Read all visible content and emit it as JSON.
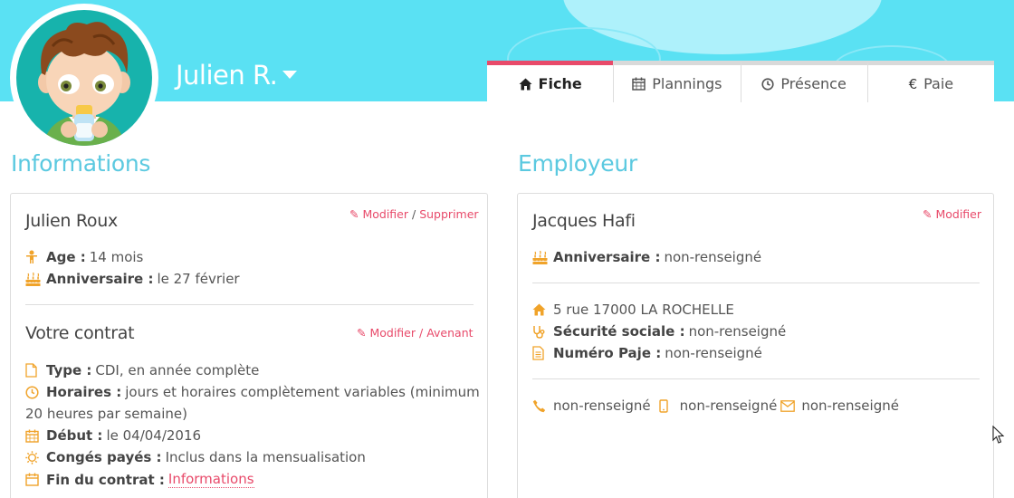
{
  "header": {
    "child_name": "Julien R.",
    "colors": {
      "sky": "#5ae1f3",
      "accent": "#e84a6a",
      "title": "#5bc9e0"
    }
  },
  "tabs": [
    {
      "label": "Fiche",
      "icon": "home-icon",
      "active": true
    },
    {
      "label": "Plannings",
      "icon": "calendar-icon",
      "active": false
    },
    {
      "label": "Présence",
      "icon": "clock-icon",
      "active": false
    },
    {
      "label": "Paie",
      "icon": "euro-icon",
      "active": false
    }
  ],
  "informations": {
    "section_title": "Informations",
    "child": {
      "name": "Julien Roux",
      "modify_label": "Modifier",
      "separator": "/",
      "delete_label": "Supprimer",
      "age_label": "Age :",
      "age_value": "14 mois",
      "birthday_label": "Anniversaire :",
      "birthday_value": "le 27 février"
    },
    "contract": {
      "title": "Votre contrat",
      "modify_label": "Modifier",
      "separator": "/",
      "amend_label": "Avenant",
      "type_label": "Type :",
      "type_value": "CDI, en année complète",
      "hours_label": "Horaires :",
      "hours_value_line1": "jours et horaires complètement variables (minimum",
      "hours_value_line2": "20 heures par semaine)",
      "start_label": "Début :",
      "start_value": "le 04/04/2016",
      "leave_label": "Congés payés :",
      "leave_value": "Inclus dans la mensualisation",
      "end_label": "Fin du contrat :",
      "end_link": "Informations"
    }
  },
  "employeur": {
    "section_title": "Employeur",
    "name": "Jacques Hafi",
    "modify_label": "Modifier",
    "birthday_label": "Anniversaire :",
    "birthday_value": "non-renseigné",
    "address": "5 rue 17000 LA ROCHELLE",
    "social_label": "Sécurité sociale :",
    "social_value": "non-renseigné",
    "paje_label": "Numéro Paje :",
    "paje_value": "non-renseigné",
    "phone_value": "non-renseigné",
    "mobile_value": "non-renseigné",
    "email_value": "non-renseigné"
  }
}
